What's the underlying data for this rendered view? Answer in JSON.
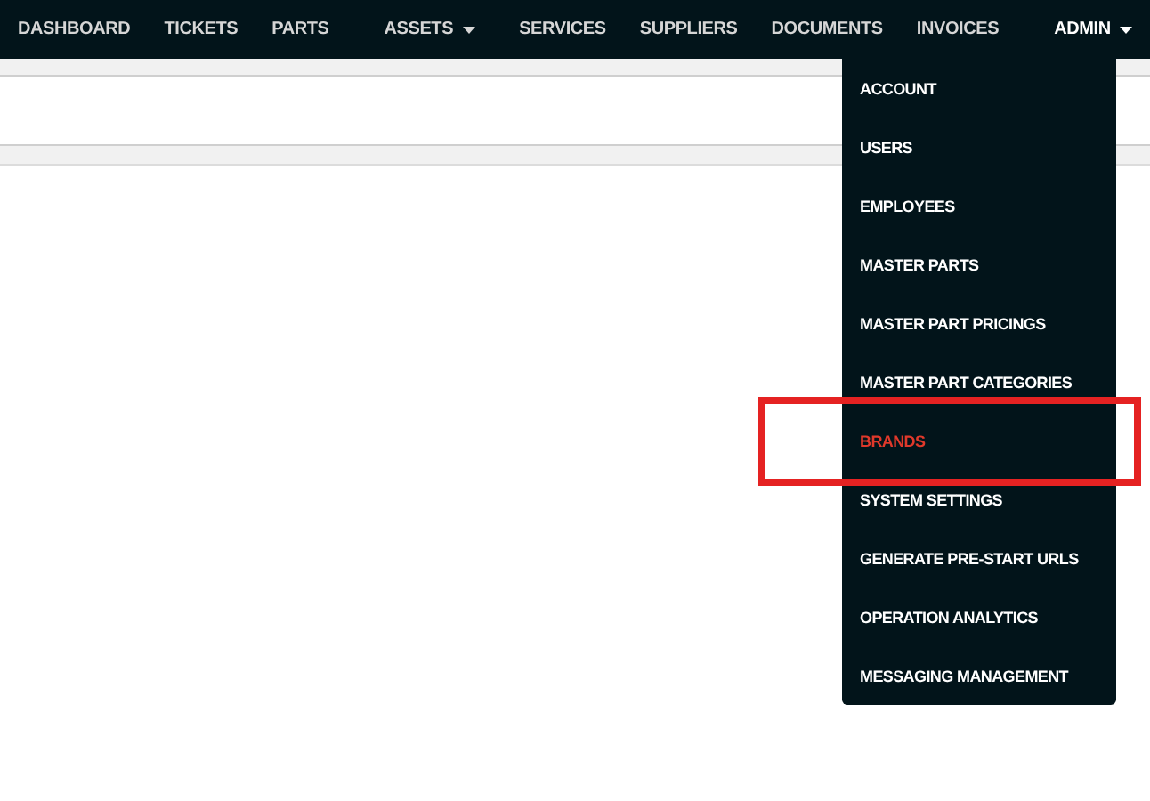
{
  "nav": [
    {
      "label": "DASHBOARD",
      "kind": "link",
      "selected": false
    },
    {
      "label": "TICKETS",
      "kind": "link",
      "selected": false
    },
    {
      "label": "PARTS",
      "kind": "link",
      "selected": false
    },
    {
      "label": "ASSETS",
      "kind": "dropdown",
      "selected": false
    },
    {
      "label": "SERVICES",
      "kind": "link",
      "selected": false
    },
    {
      "label": "SUPPLIERS",
      "kind": "link",
      "selected": false
    },
    {
      "label": "DOCUMENTS",
      "kind": "link",
      "selected": false
    },
    {
      "label": "INVOICES",
      "kind": "link",
      "selected": false
    },
    {
      "label": "ADMIN",
      "kind": "dropdown",
      "selected": true
    }
  ],
  "admin_menu": [
    {
      "label": "ACCOUNT",
      "selected": false
    },
    {
      "label": "USERS",
      "selected": false
    },
    {
      "label": "EMPLOYEES",
      "selected": false
    },
    {
      "label": "MASTER PARTS",
      "selected": false
    },
    {
      "label": "MASTER PART PRICINGS",
      "selected": false
    },
    {
      "label": "MASTER PART CATEGORIES",
      "selected": false
    },
    {
      "label": "BRANDS",
      "selected": true
    },
    {
      "label": "SYSTEM SETTINGS",
      "selected": false
    },
    {
      "label": "GENERATE PRE-START URLS",
      "selected": false
    },
    {
      "label": "OPERATION ANALYTICS",
      "selected": false
    },
    {
      "label": "MESSAGING MANAGEMENT",
      "selected": false
    }
  ]
}
